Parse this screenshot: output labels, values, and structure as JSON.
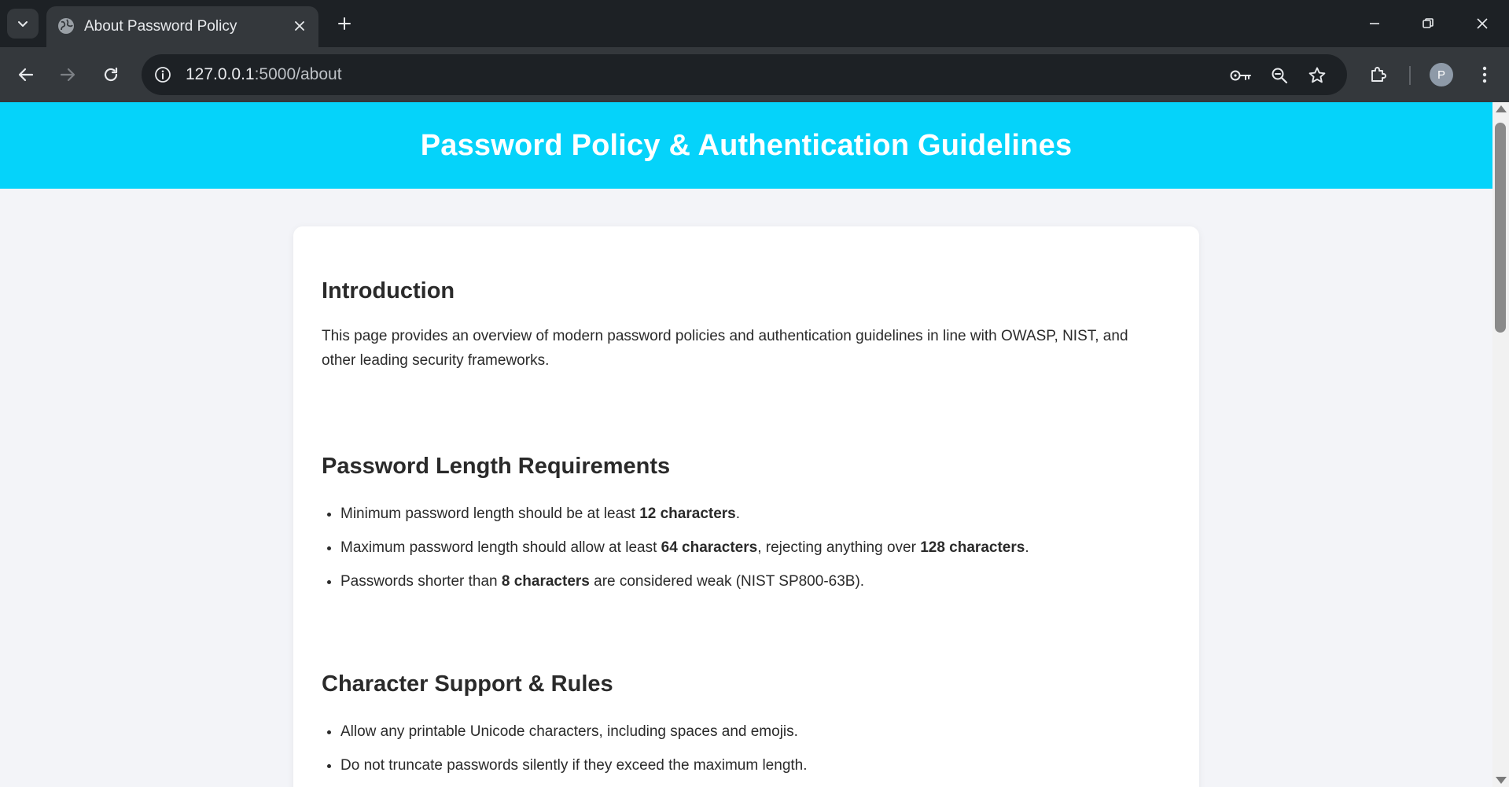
{
  "browser": {
    "tab": {
      "title": "About Password Policy"
    },
    "address": {
      "host": "127.0.0.1",
      "path": ":5000/about"
    },
    "profile_initial": "P"
  },
  "colors": {
    "hero_background": "#05d3fa",
    "chrome_dark": "#1d2125",
    "chrome_toolbar": "#34383c",
    "page_background": "#f3f4f8"
  },
  "icons": {
    "tab_search": "chevron-down-icon",
    "favicon": "globe-icon",
    "tab_close": "close-icon",
    "new_tab": "plus-icon",
    "back": "arrow-left-icon",
    "forward": "arrow-right-icon",
    "reload": "reload-icon",
    "site_info": "info-icon",
    "passwords": "key-icon",
    "zoom": "zoom-out-icon",
    "bookmark": "star-icon",
    "extensions": "puzzle-icon",
    "menu": "kebab-menu-icon"
  },
  "page": {
    "title": "Password Policy & Authentication Guidelines",
    "sections": [
      {
        "heading": "Introduction",
        "paragraph": "This page provides an overview of modern password policies and authentication guidelines in line with OWASP, NIST, and other leading security frameworks."
      },
      {
        "heading": "Password Length Requirements",
        "items": [
          {
            "before": "Minimum password length should be at least ",
            "bold1": "12 characters",
            "mid": ".",
            "bold2": "",
            "after": ""
          },
          {
            "before": "Maximum password length should allow at least ",
            "bold1": "64 characters",
            "mid": ", rejecting anything over ",
            "bold2": "128 characters",
            "after": "."
          },
          {
            "before": "Passwords shorter than ",
            "bold1": "8 characters",
            "mid": " are considered weak (NIST SP800-63B).",
            "bold2": "",
            "after": ""
          }
        ]
      },
      {
        "heading": "Character Support & Rules",
        "items": [
          {
            "text": "Allow any printable Unicode characters, including spaces and emojis."
          },
          {
            "text": "Do not truncate passwords silently if they exceed the maximum length."
          }
        ]
      }
    ]
  }
}
